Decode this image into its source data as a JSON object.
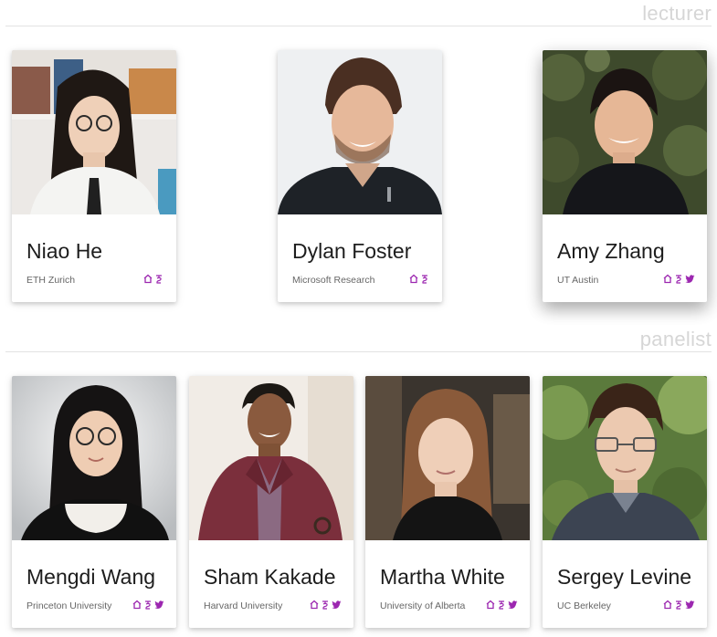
{
  "colors": {
    "accent": "#9c27b0",
    "section_title": "#d6d6d6",
    "rule": "#e3e3e3"
  },
  "sections": [
    {
      "title": "lecturer",
      "people": [
        {
          "name": "Niao He",
          "affiliation": "ETH Zurich",
          "icons": [
            "home-icon",
            "scholar-icon"
          ]
        },
        {
          "name": "Dylan Foster",
          "affiliation": "Microsoft Research",
          "icons": [
            "home-icon",
            "scholar-icon"
          ]
        },
        {
          "name": "Amy Zhang",
          "affiliation": "UT Austin",
          "icons": [
            "home-icon",
            "scholar-icon",
            "twitter-icon"
          ]
        }
      ]
    },
    {
      "title": "panelist",
      "people": [
        {
          "name": "Mengdi Wang",
          "affiliation": "Princeton University",
          "icons": [
            "home-icon",
            "scholar-icon",
            "twitter-icon"
          ]
        },
        {
          "name": "Sham Kakade",
          "affiliation": "Harvard University",
          "icons": [
            "home-icon",
            "scholar-icon",
            "twitter-icon"
          ]
        },
        {
          "name": "Martha White",
          "affiliation": "University of Alberta",
          "icons": [
            "home-icon",
            "scholar-icon",
            "twitter-icon"
          ]
        },
        {
          "name": "Sergey Levine",
          "affiliation": "UC Berkeley",
          "icons": [
            "home-icon",
            "scholar-icon",
            "twitter-icon"
          ]
        }
      ]
    }
  ]
}
